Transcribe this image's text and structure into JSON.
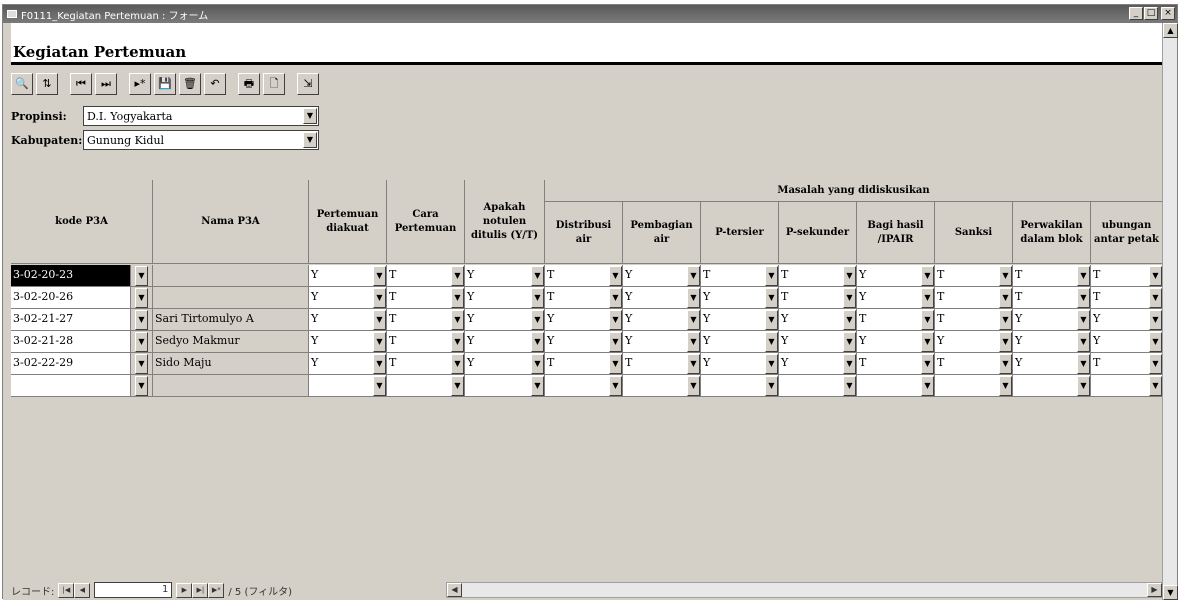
{
  "window": {
    "title": "F0111_Kegiatan Pertemuan : フォーム",
    "min_label": "_",
    "max_label": "□",
    "close_label": "×"
  },
  "form": {
    "header_title": "Kegiatan Pertemuan"
  },
  "toolbar": {
    "buttons": [
      {
        "icon": "binoculars-icon",
        "glyph": "🔍"
      },
      {
        "icon": "sort-icon",
        "glyph": "⇅"
      },
      {
        "icon": "first-record-icon",
        "glyph": "⏮"
      },
      {
        "icon": "last-record-icon",
        "glyph": "⏭"
      },
      {
        "icon": "new-record-icon",
        "glyph": "▸*"
      },
      {
        "icon": "save-icon",
        "glyph": "💾"
      },
      {
        "icon": "delete-icon",
        "glyph": "🗑"
      },
      {
        "icon": "undo-icon",
        "glyph": "↶"
      },
      {
        "icon": "print-icon",
        "glyph": "🖶"
      },
      {
        "icon": "print-preview-icon",
        "glyph": "🗋"
      },
      {
        "icon": "exit-icon",
        "glyph": "⇲"
      }
    ]
  },
  "filters": {
    "propinsi_label": "Propinsi:",
    "propinsi_value": "D.I. Yogyakarta",
    "kabupaten_label": "Kabupaten:",
    "kabupaten_value": "Gunung Kidul"
  },
  "grid": {
    "headers": {
      "kode": "kode P3A",
      "nama": "Nama P3A",
      "pertemuan": "Pertemuan diakuat",
      "cara": "Cara Pertemuan",
      "apakah": "Apakah notulen ditulis (Y/T)",
      "group": "Masalah yang didiskusikan",
      "distribusi": "Distribusi air",
      "pembagian": "Pembagian air",
      "ptersier": "P-tersier",
      "psekunder": "P-sekunder",
      "bagi": "Bagi hasil /IPAIR",
      "sanksi": "Sanksi",
      "perwakilan": "Perwakilan dalam blok",
      "hubungan": "ubungan antar petak"
    },
    "rows": [
      {
        "kode": "3-02-20-23",
        "nama": "",
        "v": [
          "Y",
          "T",
          "Y",
          "T",
          "Y",
          "T",
          "T",
          "Y",
          "T",
          "T",
          "T"
        ]
      },
      {
        "kode": "3-02-20-26",
        "nama": "",
        "v": [
          "Y",
          "T",
          "Y",
          "T",
          "Y",
          "Y",
          "T",
          "Y",
          "T",
          "T",
          "T"
        ]
      },
      {
        "kode": "3-02-21-27",
        "nama": "Sari Tirtomulyo A",
        "v": [
          "Y",
          "T",
          "Y",
          "Y",
          "Y",
          "Y",
          "Y",
          "T",
          "T",
          "Y",
          "Y"
        ]
      },
      {
        "kode": "3-02-21-28",
        "nama": "Sedyo Makmur",
        "v": [
          "Y",
          "T",
          "Y",
          "Y",
          "Y",
          "Y",
          "Y",
          "Y",
          "Y",
          "Y",
          "Y"
        ]
      },
      {
        "kode": "3-02-22-29",
        "nama": "Sido Maju",
        "v": [
          "Y",
          "T",
          "Y",
          "T",
          "T",
          "Y",
          "Y",
          "T",
          "T",
          "Y",
          "T"
        ]
      },
      {
        "kode": "",
        "nama": "",
        "v": [
          "",
          "",
          "",
          "",
          "",
          "",
          "",
          "",
          "",
          "",
          ""
        ]
      }
    ]
  },
  "status": {
    "record_label": "レコード:",
    "current": "1",
    "total_text": "/ 5 (フィルタ)"
  }
}
